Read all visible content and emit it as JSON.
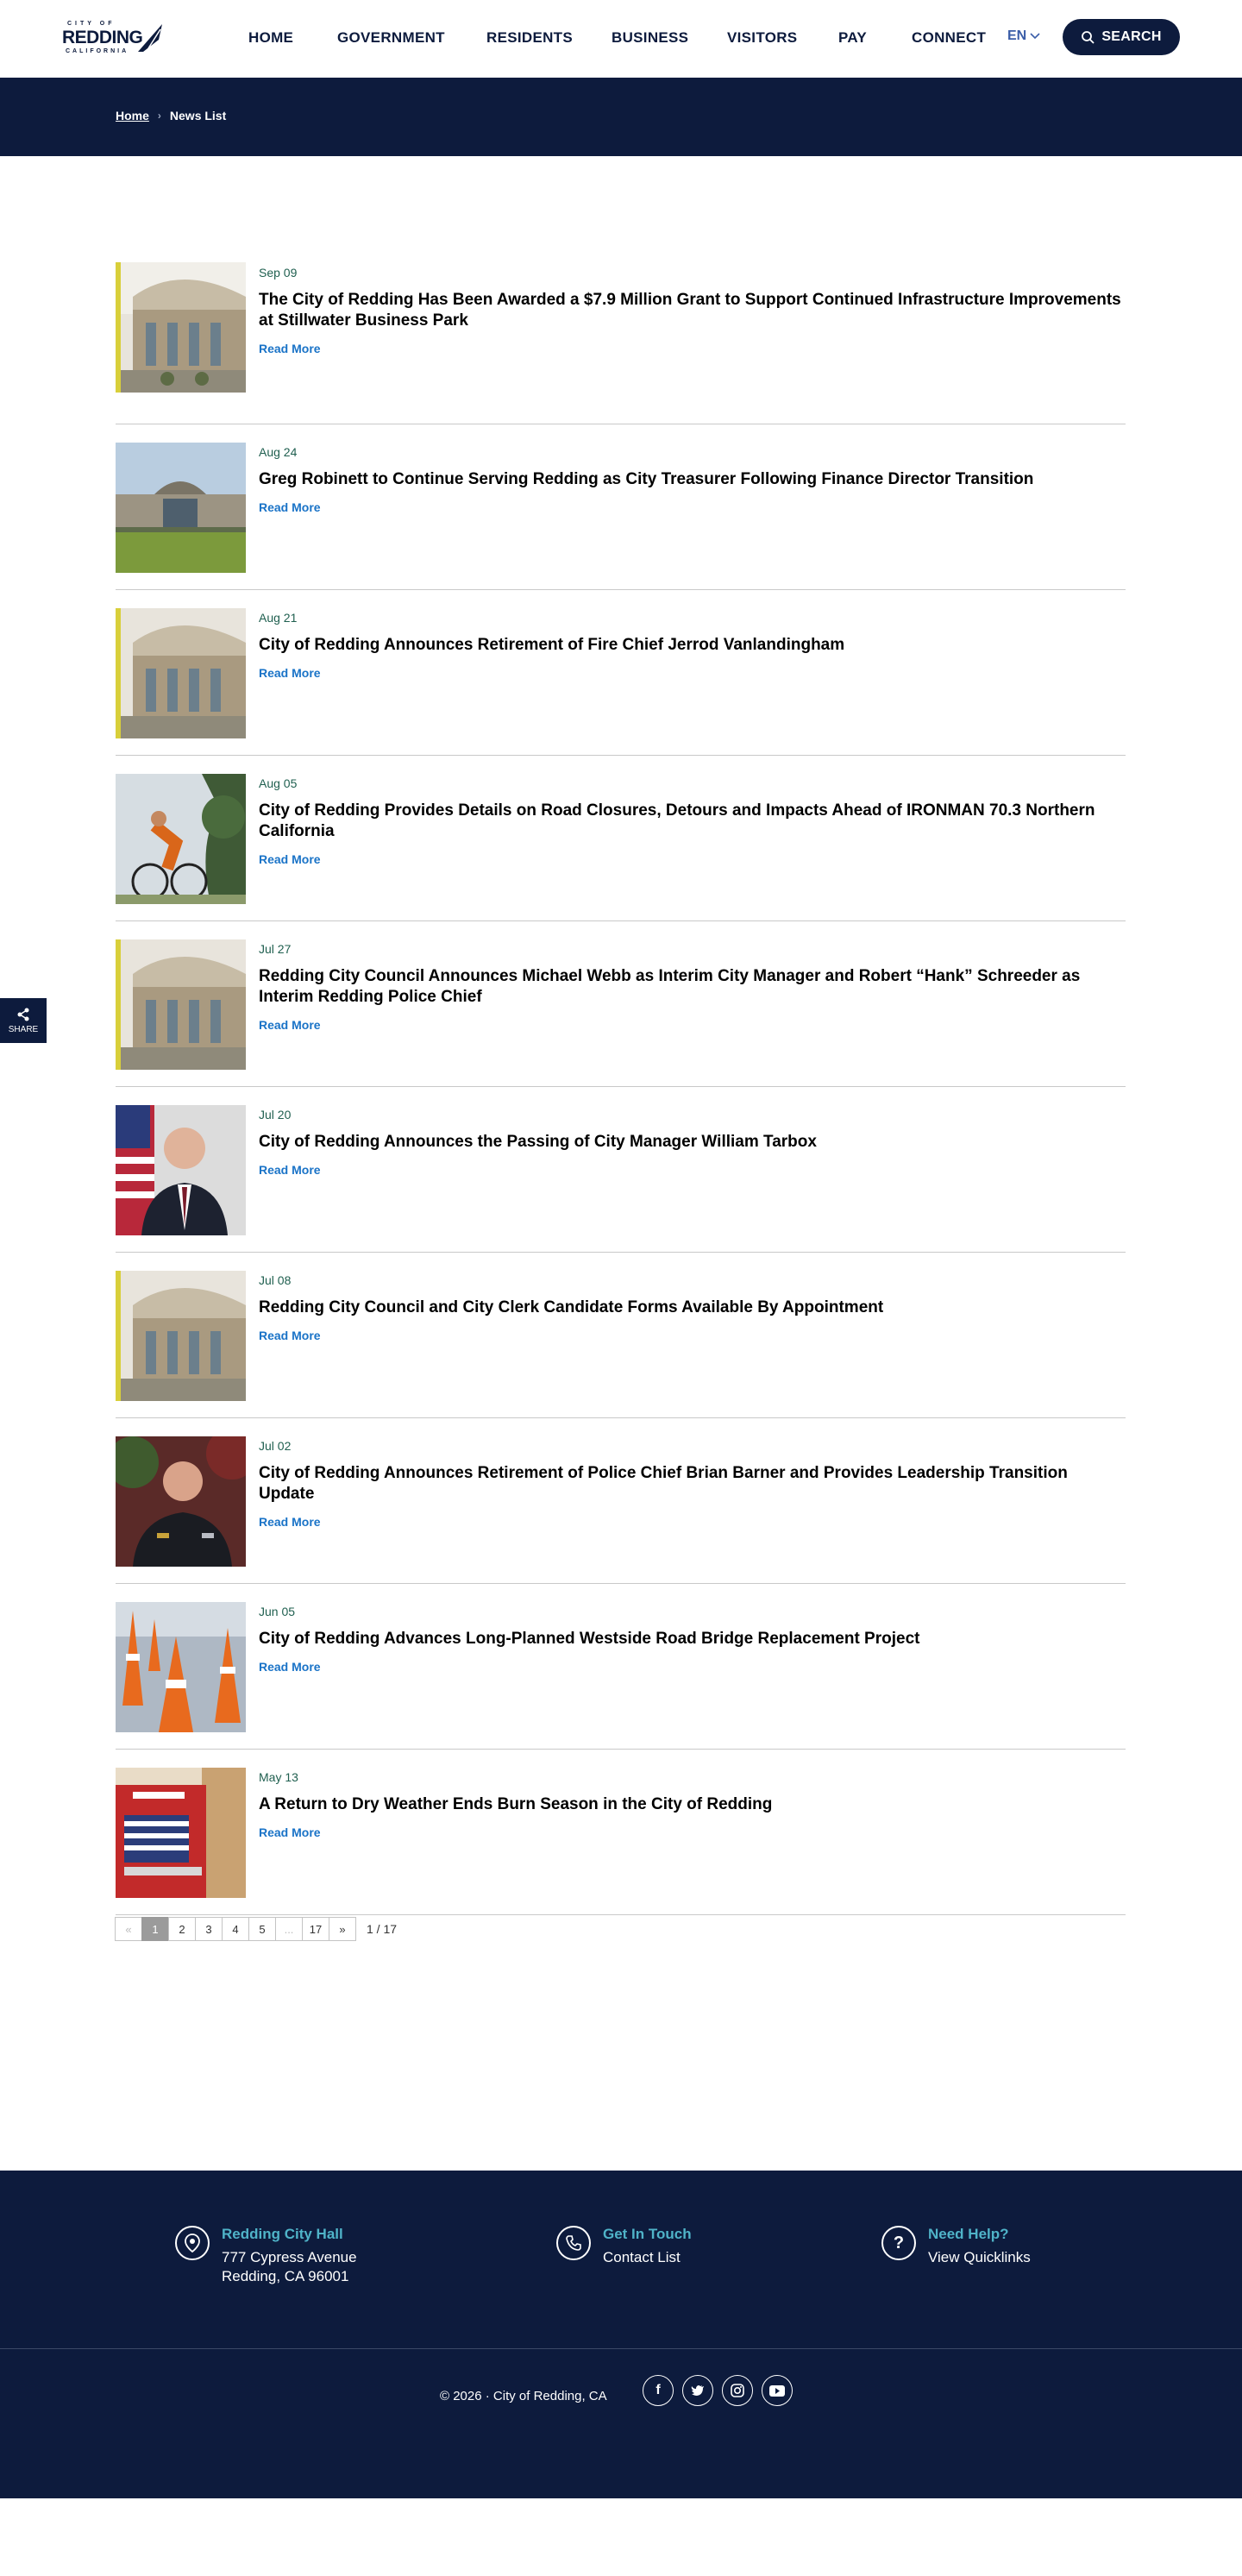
{
  "logo": {
    "top": "CITY OF",
    "main": "REDDING",
    "sub": "CALIFORNIA"
  },
  "nav": {
    "items": [
      "HOME",
      "GOVERNMENT",
      "RESIDENTS",
      "BUSINESS",
      "VISITORS",
      "PAY",
      "CONNECT"
    ],
    "lang": "EN",
    "search_label": "SEARCH"
  },
  "breadcrumb": {
    "home": "Home",
    "current": "News List"
  },
  "news": [
    {
      "date": "Sep 09",
      "title": "The City of Redding Has Been Awarded a $7.9 Million Grant to Support Continued Infrastructure Improvements at Stillwater Business Park",
      "more": "Read More",
      "image": "city-hall-photo"
    },
    {
      "date": "Aug 24",
      "title": "Greg Robinett to Continue Serving Redding as City Treasurer Following Finance Director Transition",
      "more": "Read More",
      "image": "city-hall-front-photo"
    },
    {
      "date": "Aug 21",
      "title": "City of Redding Announces Retirement of Fire Chief Jerrod Vanlandingham",
      "more": "Read More",
      "image": "city-hall-photo"
    },
    {
      "date": "Aug 05",
      "title": "City of Redding Provides Details on Road Closures, Detours and Impacts Ahead of IRONMAN 70.3 Northern California",
      "more": "Read More",
      "image": "cyclist-photo"
    },
    {
      "date": "Jul 27",
      "title": "Redding City Council Announces Michael Webb as Interim City Manager and Robert “Hank” Schreeder as Interim Redding Police Chief",
      "more": "Read More",
      "image": "city-hall-photo"
    },
    {
      "date": "Jul 20",
      "title": "City of Redding Announces the Passing of City Manager William Tarbox",
      "more": "Read More",
      "image": "portrait-photo"
    },
    {
      "date": "Jul 08",
      "title": "Redding City Council and City Clerk Candidate Forms Available By Appointment",
      "more": "Read More",
      "image": "city-hall-photo"
    },
    {
      "date": "Jul 02",
      "title": "City of Redding Announces Retirement of Police Chief Brian Barner and Provides Leadership Transition Update",
      "more": "Read More",
      "image": "police-chief-photo"
    },
    {
      "date": "Jun 05",
      "title": "City of Redding Advances Long-Planned Westside Road Bridge Replacement Project",
      "more": "Read More",
      "image": "traffic-cones-photo"
    },
    {
      "date": "May 13",
      "title": "A Return to Dry Weather Ends Burn Season in the City of Redding",
      "more": "Read More",
      "image": "fire-truck-photo"
    }
  ],
  "pagination": {
    "prev": "«",
    "pages": [
      "1",
      "2",
      "3",
      "4",
      "5",
      "...",
      "17"
    ],
    "next": "»",
    "current": "1",
    "count": "1 / 17"
  },
  "share": {
    "label": "SHARE"
  },
  "footer": {
    "city_hall": {
      "heading": "Redding City Hall",
      "line1": "777 Cypress Avenue",
      "line2": "Redding, CA 96001"
    },
    "contact": {
      "heading": "Get In Touch",
      "text": "Contact List"
    },
    "help": {
      "heading": "Need Help?",
      "text": "View Quicklinks"
    },
    "copyright": "© 2026 ·   City of Redding, CA",
    "social": [
      "facebook-icon",
      "twitter-icon",
      "instagram-icon",
      "youtube-icon"
    ]
  },
  "colors": {
    "navy": "#0d1b3d",
    "link": "#1a73c7",
    "accent": "#4fb3c8",
    "date": "#1f5f4f"
  }
}
